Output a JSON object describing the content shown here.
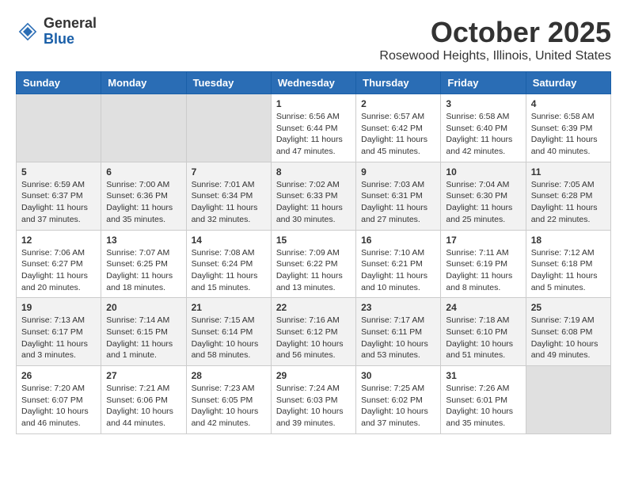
{
  "header": {
    "logo_general": "General",
    "logo_blue": "Blue",
    "month": "October 2025",
    "location": "Rosewood Heights, Illinois, United States"
  },
  "weekdays": [
    "Sunday",
    "Monday",
    "Tuesday",
    "Wednesday",
    "Thursday",
    "Friday",
    "Saturday"
  ],
  "weeks": [
    [
      {
        "day": "",
        "info": ""
      },
      {
        "day": "",
        "info": ""
      },
      {
        "day": "",
        "info": ""
      },
      {
        "day": "1",
        "info": "Sunrise: 6:56 AM\nSunset: 6:44 PM\nDaylight: 11 hours\nand 47 minutes."
      },
      {
        "day": "2",
        "info": "Sunrise: 6:57 AM\nSunset: 6:42 PM\nDaylight: 11 hours\nand 45 minutes."
      },
      {
        "day": "3",
        "info": "Sunrise: 6:58 AM\nSunset: 6:40 PM\nDaylight: 11 hours\nand 42 minutes."
      },
      {
        "day": "4",
        "info": "Sunrise: 6:58 AM\nSunset: 6:39 PM\nDaylight: 11 hours\nand 40 minutes."
      }
    ],
    [
      {
        "day": "5",
        "info": "Sunrise: 6:59 AM\nSunset: 6:37 PM\nDaylight: 11 hours\nand 37 minutes."
      },
      {
        "day": "6",
        "info": "Sunrise: 7:00 AM\nSunset: 6:36 PM\nDaylight: 11 hours\nand 35 minutes."
      },
      {
        "day": "7",
        "info": "Sunrise: 7:01 AM\nSunset: 6:34 PM\nDaylight: 11 hours\nand 32 minutes."
      },
      {
        "day": "8",
        "info": "Sunrise: 7:02 AM\nSunset: 6:33 PM\nDaylight: 11 hours\nand 30 minutes."
      },
      {
        "day": "9",
        "info": "Sunrise: 7:03 AM\nSunset: 6:31 PM\nDaylight: 11 hours\nand 27 minutes."
      },
      {
        "day": "10",
        "info": "Sunrise: 7:04 AM\nSunset: 6:30 PM\nDaylight: 11 hours\nand 25 minutes."
      },
      {
        "day": "11",
        "info": "Sunrise: 7:05 AM\nSunset: 6:28 PM\nDaylight: 11 hours\nand 22 minutes."
      }
    ],
    [
      {
        "day": "12",
        "info": "Sunrise: 7:06 AM\nSunset: 6:27 PM\nDaylight: 11 hours\nand 20 minutes."
      },
      {
        "day": "13",
        "info": "Sunrise: 7:07 AM\nSunset: 6:25 PM\nDaylight: 11 hours\nand 18 minutes."
      },
      {
        "day": "14",
        "info": "Sunrise: 7:08 AM\nSunset: 6:24 PM\nDaylight: 11 hours\nand 15 minutes."
      },
      {
        "day": "15",
        "info": "Sunrise: 7:09 AM\nSunset: 6:22 PM\nDaylight: 11 hours\nand 13 minutes."
      },
      {
        "day": "16",
        "info": "Sunrise: 7:10 AM\nSunset: 6:21 PM\nDaylight: 11 hours\nand 10 minutes."
      },
      {
        "day": "17",
        "info": "Sunrise: 7:11 AM\nSunset: 6:19 PM\nDaylight: 11 hours\nand 8 minutes."
      },
      {
        "day": "18",
        "info": "Sunrise: 7:12 AM\nSunset: 6:18 PM\nDaylight: 11 hours\nand 5 minutes."
      }
    ],
    [
      {
        "day": "19",
        "info": "Sunrise: 7:13 AM\nSunset: 6:17 PM\nDaylight: 11 hours\nand 3 minutes."
      },
      {
        "day": "20",
        "info": "Sunrise: 7:14 AM\nSunset: 6:15 PM\nDaylight: 11 hours\nand 1 minute."
      },
      {
        "day": "21",
        "info": "Sunrise: 7:15 AM\nSunset: 6:14 PM\nDaylight: 10 hours\nand 58 minutes."
      },
      {
        "day": "22",
        "info": "Sunrise: 7:16 AM\nSunset: 6:12 PM\nDaylight: 10 hours\nand 56 minutes."
      },
      {
        "day": "23",
        "info": "Sunrise: 7:17 AM\nSunset: 6:11 PM\nDaylight: 10 hours\nand 53 minutes."
      },
      {
        "day": "24",
        "info": "Sunrise: 7:18 AM\nSunset: 6:10 PM\nDaylight: 10 hours\nand 51 minutes."
      },
      {
        "day": "25",
        "info": "Sunrise: 7:19 AM\nSunset: 6:08 PM\nDaylight: 10 hours\nand 49 minutes."
      }
    ],
    [
      {
        "day": "26",
        "info": "Sunrise: 7:20 AM\nSunset: 6:07 PM\nDaylight: 10 hours\nand 46 minutes."
      },
      {
        "day": "27",
        "info": "Sunrise: 7:21 AM\nSunset: 6:06 PM\nDaylight: 10 hours\nand 44 minutes."
      },
      {
        "day": "28",
        "info": "Sunrise: 7:23 AM\nSunset: 6:05 PM\nDaylight: 10 hours\nand 42 minutes."
      },
      {
        "day": "29",
        "info": "Sunrise: 7:24 AM\nSunset: 6:03 PM\nDaylight: 10 hours\nand 39 minutes."
      },
      {
        "day": "30",
        "info": "Sunrise: 7:25 AM\nSunset: 6:02 PM\nDaylight: 10 hours\nand 37 minutes."
      },
      {
        "day": "31",
        "info": "Sunrise: 7:26 AM\nSunset: 6:01 PM\nDaylight: 10 hours\nand 35 minutes."
      },
      {
        "day": "",
        "info": ""
      }
    ]
  ]
}
